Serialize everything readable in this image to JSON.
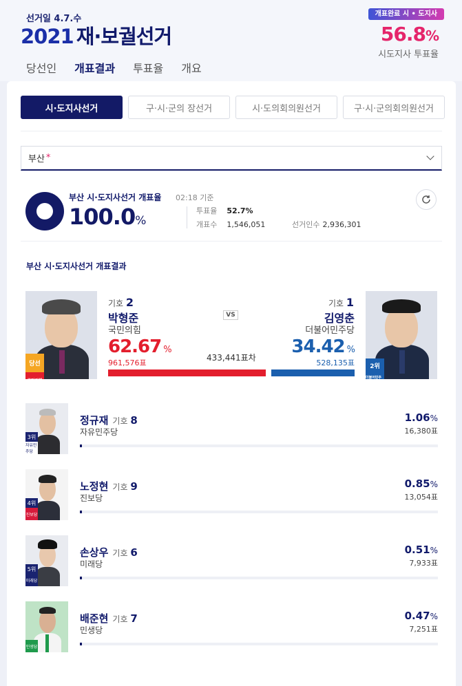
{
  "header": {
    "election_day": "선거일 4.7.수",
    "logo_year": "2021",
    "logo_name": "재·보궐선거",
    "status_badge": "개표완료 시 • 도지사",
    "turnout_value": "56.8",
    "turnout_unit": "%",
    "turnout_caption": "시도지사 투표율",
    "nav_tabs": [
      "당선인",
      "개표결과",
      "투표율",
      "개요"
    ],
    "active_nav": 1
  },
  "election_tabs": [
    "시·도지사선거",
    "구·시·군의 장선거",
    "시·도의회의원선거",
    "구·시·군의회의원선거"
  ],
  "region": {
    "value": "부산",
    "required_mark": "*"
  },
  "count": {
    "title": "부산 시·도지사선거 개표율",
    "time": "02:18 기준",
    "value": "100.0",
    "unit": "%",
    "turnout_label": "투표율",
    "turnout_value": "52.7%",
    "counted_label": "개표수",
    "counted_value": "1,546,051",
    "electorate_label": "선거인수",
    "electorate_value": "2,936,301"
  },
  "result_title": "부산 시·도지사선거 개표결과",
  "winner": {
    "num_label": "기호",
    "num": "2",
    "name": "박형준",
    "party": "국민의힘",
    "pct": "62.67",
    "pct_unit": "%",
    "votes": "961,576표",
    "badge": "당선",
    "party_logo": "국민의힘",
    "share": 0.6267
  },
  "runner_up": {
    "num_label": "기호",
    "num": "1",
    "name": "김영춘",
    "party": "더불어민주당",
    "pct": "34.42",
    "pct_unit": "%",
    "votes": "528,135표",
    "rank": "2위",
    "party_logo": "더불어민주당",
    "share": 0.3442
  },
  "vs": "VS",
  "gap": "433,441표차",
  "minor": [
    {
      "name": "정규재",
      "num_label": "기호",
      "num": "8",
      "party": "자유민주당",
      "pct": "1.06",
      "pct_unit": "%",
      "votes": "16,380표",
      "rank": "3위",
      "logo": "자유민주당",
      "share": 0.0106,
      "logo_color": "#ffffff"
    },
    {
      "name": "노정현",
      "num_label": "기호",
      "num": "9",
      "party": "진보당",
      "pct": "0.85",
      "pct_unit": "%",
      "votes": "13,054표",
      "rank": "4위",
      "logo": "진보당",
      "share": 0.0085,
      "logo_color": "#d81b3c"
    },
    {
      "name": "손상우",
      "num_label": "기호",
      "num": "6",
      "party": "미래당",
      "pct": "0.51",
      "pct_unit": "%",
      "votes": "7,933표",
      "rank": "5위",
      "logo": "미래당",
      "share": 0.0051,
      "logo_color": "#1a2370"
    },
    {
      "name": "배준현",
      "num_label": "기호",
      "num": "7",
      "party": "민생당",
      "pct": "0.47",
      "pct_unit": "%",
      "votes": "7,251표",
      "rank": "",
      "logo": "민생당",
      "share": 0.0047,
      "logo_color": "#1f9a4c"
    }
  ],
  "colors": {
    "accent": "#131a66",
    "red": "#e31e2d",
    "blue": "#1b5fae",
    "pink": "#e5256b"
  }
}
